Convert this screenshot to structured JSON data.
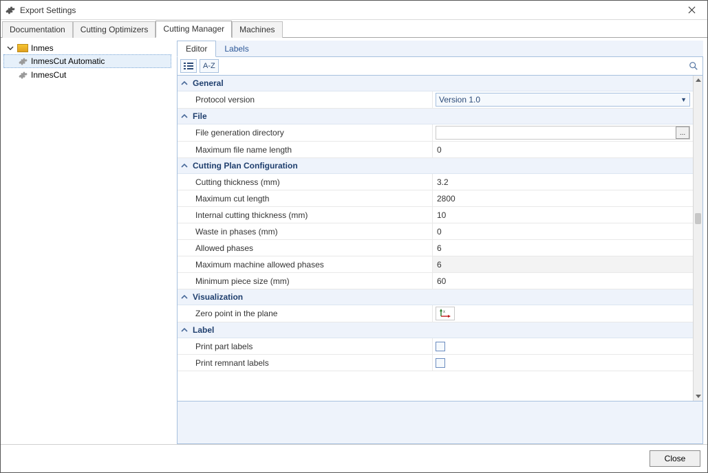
{
  "window": {
    "title": "Export Settings"
  },
  "topTabs": {
    "items": [
      {
        "label": "Documentation"
      },
      {
        "label": "Cutting Optimizers"
      },
      {
        "label": "Cutting Manager"
      },
      {
        "label": "Machines"
      }
    ]
  },
  "tree": {
    "root": "Inmes",
    "items": [
      {
        "label": "InmesCut Automatic"
      },
      {
        "label": "InmesCut"
      }
    ]
  },
  "innerTabs": {
    "items": [
      {
        "label": "Editor"
      },
      {
        "label": "Labels"
      }
    ]
  },
  "toolbar": {
    "az": "A-Z"
  },
  "sections": {
    "general": {
      "title": "General",
      "protocolLabel": "Protocol version",
      "protocolValue": "Version 1.0"
    },
    "file": {
      "title": "File",
      "dirLabel": "File generation directory",
      "dirValue": "",
      "maxNameLabel": "Maximum file name length",
      "maxNameValue": "0"
    },
    "cutting": {
      "title": "Cutting Plan Configuration",
      "thickLabel": "Cutting thickness (mm)",
      "thickValue": "3.2",
      "maxCutLabel": "Maximum cut length",
      "maxCutValue": "2800",
      "intThickLabel": "Internal cutting thickness (mm)",
      "intThickValue": "10",
      "wasteLabel": "Waste in phases (mm)",
      "wasteValue": "0",
      "allowedLabel": "Allowed phases",
      "allowedValue": "6",
      "maxMachLabel": "Maximum machine allowed phases",
      "maxMachValue": "6",
      "minPieceLabel": "Minimum piece size (mm)",
      "minPieceValue": "60"
    },
    "viz": {
      "title": "Visualization",
      "zeroLabel": "Zero point in the plane"
    },
    "label": {
      "title": "Label",
      "printPartLabel": "Print part labels",
      "printRemLabel": "Print remnant labels"
    }
  },
  "browseBtn": "...",
  "footer": {
    "close": "Close"
  }
}
